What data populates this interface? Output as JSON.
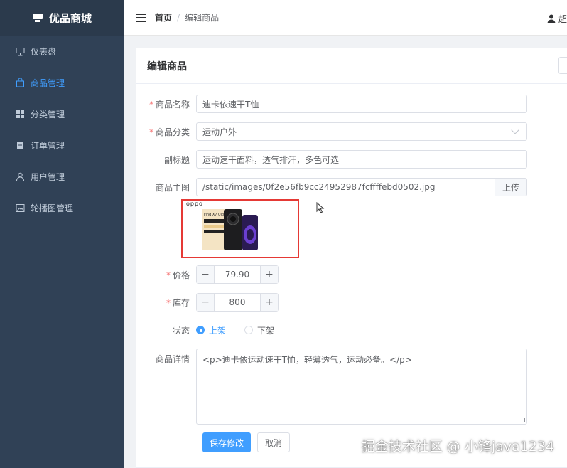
{
  "brand": {
    "title": "优品商城"
  },
  "sidebar": {
    "items": [
      {
        "label": "仪表盘",
        "icon": "dashboard-icon"
      },
      {
        "label": "商品管理",
        "icon": "bag-icon",
        "active": true
      },
      {
        "label": "分类管理",
        "icon": "grid-icon"
      },
      {
        "label": "订单管理",
        "icon": "clipboard-icon"
      },
      {
        "label": "用户管理",
        "icon": "user-icon"
      },
      {
        "label": "轮播图管理",
        "icon": "image-icon"
      }
    ]
  },
  "header": {
    "breadcrumb_home": "首页",
    "breadcrumb_sep": "/",
    "breadcrumb_current": "编辑商品",
    "user_name": "超"
  },
  "card": {
    "title": "编辑商品"
  },
  "form": {
    "name": {
      "label": "商品名称",
      "value": "迪卡依速干T恤"
    },
    "category": {
      "label": "商品分类",
      "value": "运动户外"
    },
    "subtitle": {
      "label": "副标题",
      "value": "运动速干面料，透气排汗，多色可选"
    },
    "image": {
      "label": "商品主图",
      "value": "/static/images/0f2e56fb9cc24952987fcffffebd0502.jpg",
      "upload_label": "上传"
    },
    "preview": {
      "brand": "oppo",
      "model": "Find X7 Ultra"
    },
    "price": {
      "label": "价格",
      "value": "79.90",
      "minus": "−",
      "plus": "+"
    },
    "stock": {
      "label": "库存",
      "value": "800",
      "minus": "−",
      "plus": "+"
    },
    "status": {
      "label": "状态",
      "options": [
        "上架",
        "下架"
      ],
      "selected": "上架"
    },
    "detail": {
      "label": "商品详情",
      "value": "<p>迪卡依运动速干T恤，轻薄透气，运动必备。</p>"
    },
    "save_label": "保存修改",
    "cancel_label": "取消"
  },
  "watermark": "掘金技术社区 @ 小锋java1234",
  "colors": {
    "sidebar_bg": "#304156",
    "primary": "#409eff",
    "required": "#f56c6c",
    "highlight_border": "#e53935"
  }
}
